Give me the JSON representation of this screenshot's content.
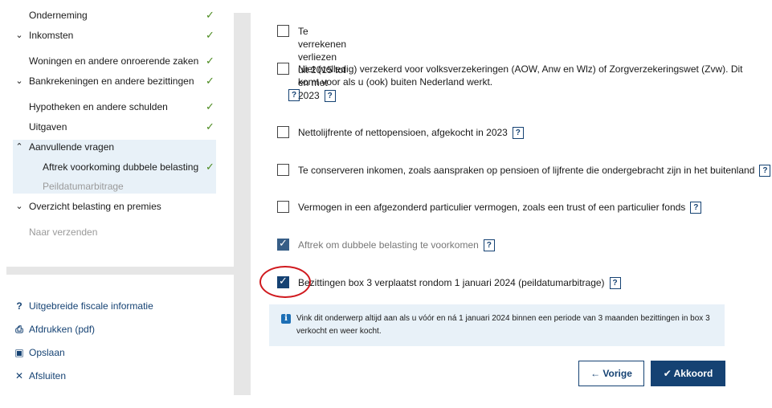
{
  "sidebar": {
    "nav": [
      {
        "label": "Onderneming",
        "check": "✓"
      },
      {
        "label": "Inkomsten",
        "chevron": "⌄",
        "check": "✓"
      },
      {
        "label": "Woningen en andere onroerende zaken",
        "check": "✓"
      },
      {
        "label": "Bankrekeningen en andere bezittingen",
        "chevron": "⌄",
        "check": "✓"
      },
      {
        "label": "Hypotheken en andere schulden",
        "check": "✓"
      },
      {
        "label": "Uitgaven",
        "check": "✓"
      },
      {
        "label": "Aanvullende vragen",
        "chevron": "⌃"
      },
      {
        "label": "Aftrek voorkoming dubbele belasting",
        "check": "✓"
      },
      {
        "label": "Peildatumarbitrage"
      },
      {
        "label": "Overzicht belasting en premies",
        "chevron": "⌄"
      },
      {
        "label": "Naar verzenden"
      }
    ],
    "links": [
      {
        "icon": "?",
        "label": "Uitgebreide fiscale informatie"
      },
      {
        "icon": "⎙",
        "label": "Afdrukken (pdf)"
      },
      {
        "icon": "▣",
        "label": "Opslaan"
      },
      {
        "icon": "✕",
        "label": "Afsluiten"
      }
    ]
  },
  "main": {
    "items": [
      {
        "label": "Te verrekenen verliezen uit 2015 tot en met 2023",
        "checked": false
      },
      {
        "label_line1": "Niet (volledig) verzekerd voor volksverzekeringen (AOW, Anw en Wlz) of Zorgverzekeringswet (Zvw). Dit",
        "label_line2": "komt voor als u (ook) buiten Nederland werkt.",
        "checked": false
      },
      {
        "label": "Nettolijfrente of nettopensioen, afgekocht in 2023",
        "checked": false
      },
      {
        "label": "Te conserveren inkomen, zoals aanspraken op pensioen of lijfrente die ondergebracht zijn in het buitenland",
        "checked": false
      },
      {
        "label": "Vermogen in een afgezonderd particulier vermogen, zoals een trust of een particulier fonds",
        "checked": false
      },
      {
        "label": "Aftrek om dubbele belasting te voorkomen",
        "checked": true
      },
      {
        "label": "Bezittingen box 3 verplaatst rondom 1 januari 2024 (peildatumarbitrage)",
        "checked": true
      }
    ],
    "help_label": "?",
    "info": {
      "icon": "i",
      "text": "Vink dit onderwerp altijd aan als u vóór en ná 1 januari 2024 binnen een periode van 3 maanden bezittingen in box 3 verkocht en weer kocht."
    },
    "buttons": {
      "prev": "← Vorige",
      "ok": "✔ Akkoord"
    }
  },
  "colors": {
    "brand": "#154273",
    "check": "#4a8a1e",
    "info_bg": "#e8f1f8",
    "annotation": "#d0191e"
  }
}
